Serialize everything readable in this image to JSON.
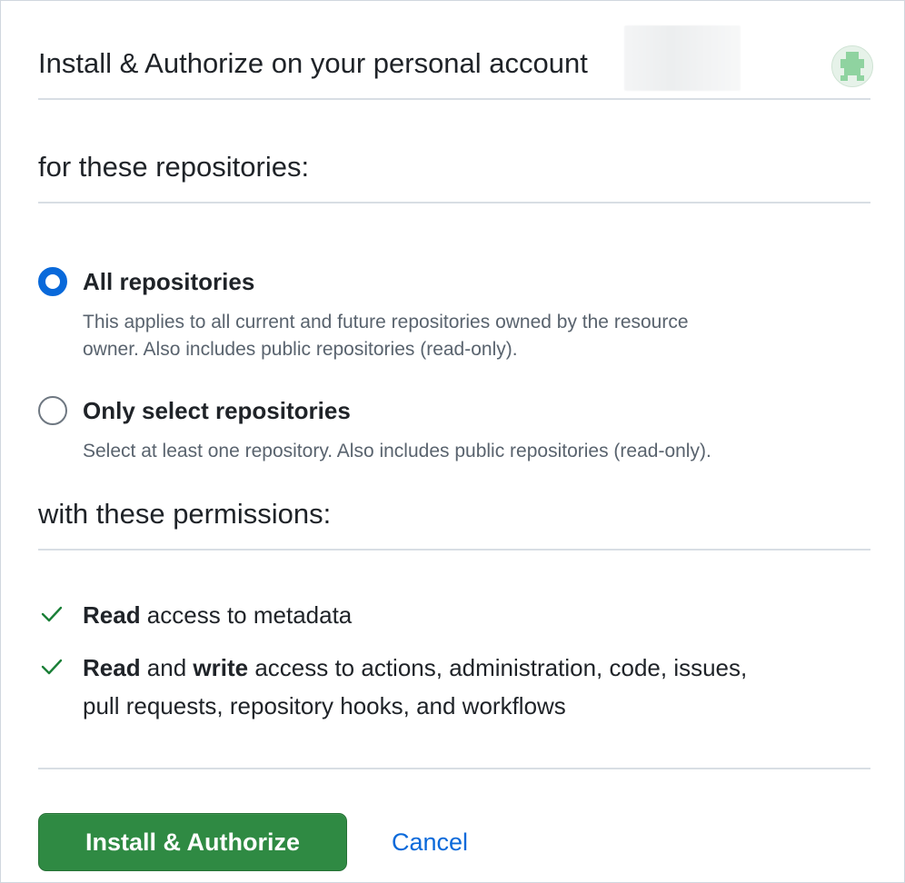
{
  "header": {
    "title": "Install & Authorize on your personal account",
    "account_icon": "identicon-avatar"
  },
  "repositories": {
    "heading": "for these repositories:",
    "options": [
      {
        "label": "All repositories",
        "description_line1": "This applies to all current and future repositories owned by the resource",
        "description_line2": "owner. Also includes public repositories (read-only).",
        "selected": true
      },
      {
        "label": "Only select repositories",
        "description_line1": "Select at least one repository. Also includes public repositories (read-only).",
        "selected": false
      }
    ]
  },
  "permissions": {
    "heading": "with these permissions:",
    "items": [
      {
        "icon": "check-icon",
        "strong1": "Read",
        "text1": " access to metadata"
      },
      {
        "icon": "check-icon",
        "strong1": "Read",
        "mid": " and ",
        "strong2": "write",
        "text_line1": " access to actions, administration, code, issues,",
        "text_line2": "pull requests, repository hooks, and workflows"
      }
    ]
  },
  "actions": {
    "primary_label": "Install & Authorize",
    "cancel_label": "Cancel"
  },
  "colors": {
    "accent": "#0969da",
    "primary_button": "#2f8a43",
    "check": "#1a7f37",
    "muted_text": "#59636e"
  }
}
